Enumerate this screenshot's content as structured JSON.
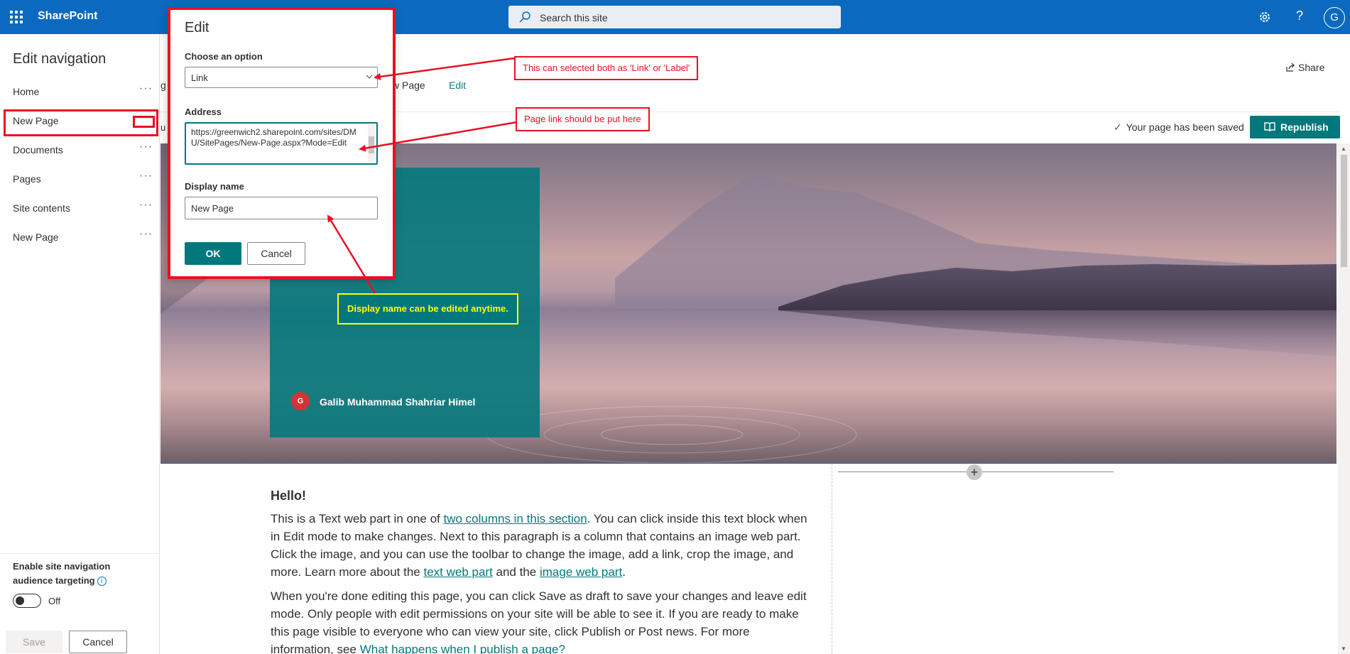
{
  "suite": {
    "app_name": "SharePoint",
    "search_placeholder": "Search this site",
    "avatar_initial": "G",
    "help_glyph": "?"
  },
  "nav": {
    "title": "Edit navigation",
    "items": [
      {
        "label": "Home",
        "more": "···"
      },
      {
        "label": "New Page",
        "more": "···"
      },
      {
        "label": "Documents",
        "more": "···"
      },
      {
        "label": "Pages",
        "more": "···"
      },
      {
        "label": "Site contents",
        "more": "···"
      },
      {
        "label": "New Page",
        "more": "···"
      }
    ],
    "audience_label": "Enable site navigation audience targeting",
    "info_glyph": "i",
    "toggle_state": "Off",
    "save_label": "Save",
    "cancel_label": "Cancel"
  },
  "header": {
    "crumb_partial": "g",
    "crumb_page": "w Page",
    "crumb_edit": "Edit",
    "left_trunc": "u",
    "share_label": "Share",
    "saved_text": "Your page has been saved",
    "republish_label": "Republish"
  },
  "hero": {
    "author_initial": "G",
    "author_name": "Galib Muhammad Shahriar Himel"
  },
  "content": {
    "heading": "Hello!",
    "para1": {
      "t1": "This is a Text web part in one of ",
      "link1": "two columns in this section",
      "t2": ". You can click inside this text block when in Edit mode to make changes. Next to this paragraph is a column that contains an image web part. Click the image, and you can use the toolbar to change the image, add a link, crop the image, and more. Learn more about the ",
      "link2": "text web part",
      "t3": " and the ",
      "link3": "image web part",
      "t4": "."
    },
    "para2": {
      "t1": "When you're done editing this page, you can click Save as draft to save your changes and leave edit mode. Only people with edit permissions on your site will be able to see it. If you are ready to make this page visible to everyone who can view your site, click Publish or Post news. For more information, see ",
      "link1": "What happens when I publish a page?"
    }
  },
  "dialog": {
    "title": "Edit",
    "option_label": "Choose an option",
    "option_value": "Link",
    "address_label": "Address",
    "address_value": "https://greenwich2.sharepoint.com/sites/DMU/SitePages/New-Page.aspx?Mode=Edit",
    "display_label": "Display name",
    "display_value": "New Page",
    "ok_label": "OK",
    "cancel_label": "Cancel"
  },
  "annotations": {
    "link_or_label": "This can selected both as 'Link' or 'Label'",
    "page_link": "Page link should be put here",
    "display_name": "Display name can be edited anytime.",
    "red": "#e81123",
    "yellow": "#ffff00"
  },
  "colors": {
    "suite_blue": "#0b6ac0",
    "teal": "#03787c"
  }
}
